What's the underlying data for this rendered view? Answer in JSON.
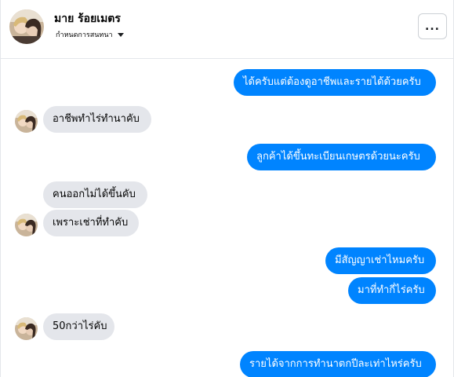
{
  "header": {
    "name": "มาย ร้อยเมตร",
    "subtitle": "กำหนดการสนทนา",
    "more_label": "..."
  },
  "messages": [
    {
      "side": "out",
      "text": "ได้ครับแต่ต้องดูอาชีพและรายได้ด้วยครับ"
    },
    {
      "side": "in",
      "text": "อาชีพทำไร่ทำนาคับ"
    },
    {
      "side": "out",
      "text": "ลูกค้าได้ขึ้นทะเบียนเกษตรด้วยนะครับ"
    },
    {
      "side": "in",
      "text": "คนออกไม่ได้ขึ้นคับ"
    },
    {
      "side": "in",
      "text": "เพราะเช่าที่ทำคับ"
    },
    {
      "side": "out",
      "text": "มีสัญญาเช่าไหมครับ"
    },
    {
      "side": "out",
      "text": "มาที่ทำกี่ไร่ครับ"
    },
    {
      "side": "in",
      "text": "50กว่าไร่คับ"
    },
    {
      "side": "out",
      "text": "รายได้จากการทำนาตกปีละเท่าไหร่ครับ"
    }
  ],
  "colors": {
    "outgoing": "#0084ff",
    "incoming": "#e4e6eb"
  }
}
